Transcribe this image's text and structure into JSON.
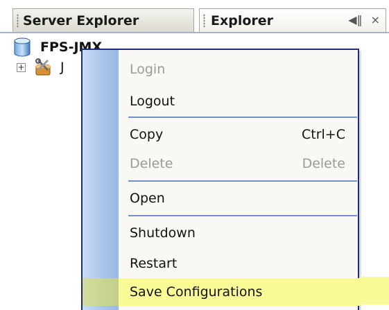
{
  "tabs": [
    {
      "label": "Server Explorer"
    },
    {
      "label": "Explorer"
    }
  ],
  "tab_controls": {
    "pin": "◀‖",
    "close": "×"
  },
  "tree": {
    "server_node": {
      "label": "FPS-JMX",
      "icon": "database-icon"
    },
    "child_node": {
      "label": "J",
      "icon": "tools-icon",
      "expander": "+"
    }
  },
  "context_menu": {
    "items": [
      {
        "label": "Login",
        "shortcut": "",
        "disabled": true
      },
      {
        "label": "Logout",
        "shortcut": "",
        "disabled": false
      },
      {
        "label": "Copy",
        "shortcut": "Ctrl+C",
        "disabled": false
      },
      {
        "label": "Delete",
        "shortcut": "Delete",
        "disabled": true
      },
      {
        "label": "Open",
        "shortcut": "",
        "disabled": false
      },
      {
        "label": "Shutdown",
        "shortcut": "",
        "disabled": false
      },
      {
        "label": "Restart",
        "shortcut": "",
        "disabled": false
      },
      {
        "label": "Save Configurations",
        "shortcut": "",
        "disabled": false,
        "highlighted": true
      }
    ]
  },
  "colors": {
    "menu_border": "#1c2d78",
    "menu_gutter": "#a9c3ea",
    "separator": "#6f8fcf",
    "highlight": "#fafa96",
    "disabled_text": "#9a9a9a"
  }
}
